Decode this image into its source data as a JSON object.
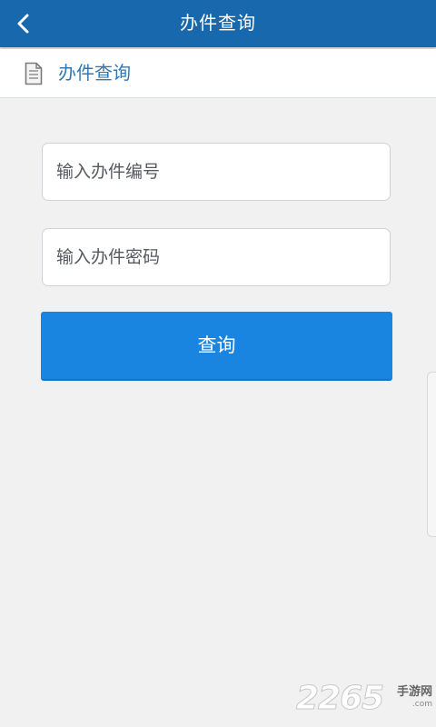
{
  "header": {
    "title": "办件查询",
    "back_icon": "chevron-left-icon",
    "background_color": "#1768ad"
  },
  "subheader": {
    "icon": "document-icon",
    "title": "办件查询",
    "title_color": "#2f78b8"
  },
  "form": {
    "number_placeholder": "输入办件编号",
    "number_value": "",
    "password_placeholder": "输入办件密码",
    "password_value": "",
    "submit_label": "查询",
    "submit_color": "#1a85e0"
  },
  "watermark": {
    "number": "2265",
    "site_name": "手游网",
    "url": ".com"
  }
}
